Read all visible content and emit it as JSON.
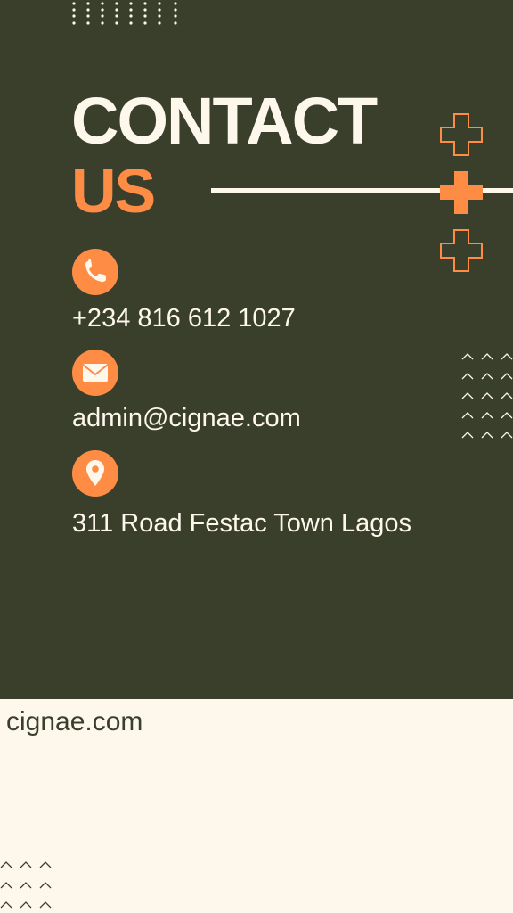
{
  "heading": {
    "line1": "CONTACT",
    "line2": "US"
  },
  "contacts": {
    "phone": {
      "text": "+234 816 612 1027",
      "icon": "phone-icon"
    },
    "email": {
      "text": "admin@cignae.com",
      "icon": "envelope-icon"
    },
    "address": {
      "text": "311 Road Festac Town Lagos",
      "icon": "location-pin-icon"
    }
  },
  "footer": {
    "website": "cignae.com"
  },
  "colors": {
    "background_dark": "#3a3f2c",
    "background_light": "#fdf7ec",
    "accent": "#ff8c45",
    "text_light": "#fdf7ec"
  }
}
